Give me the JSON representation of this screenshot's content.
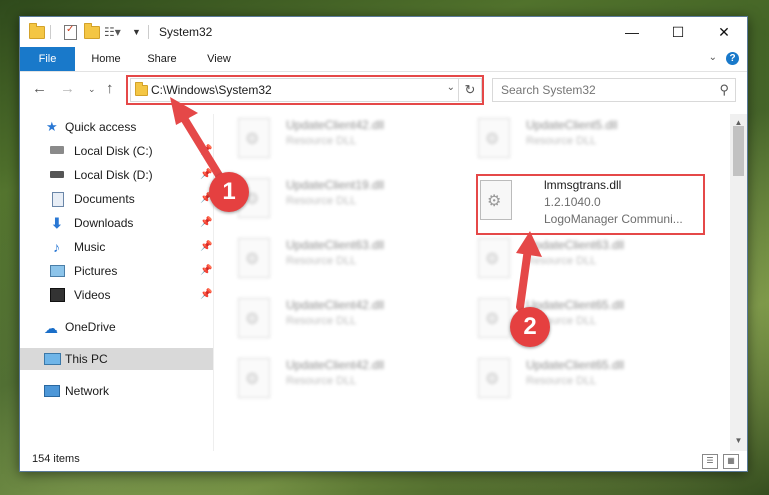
{
  "window": {
    "title": "System32"
  },
  "ribbon": {
    "tabs": [
      "File",
      "Home",
      "Share",
      "View"
    ]
  },
  "nav": {
    "address": "C:\\Windows\\System32",
    "search_placeholder": "Search System32"
  },
  "sidebar": {
    "items": [
      {
        "label": "Quick access"
      },
      {
        "label": "Local Disk (C:)"
      },
      {
        "label": "Local Disk (D:)"
      },
      {
        "label": "Documents"
      },
      {
        "label": "Downloads"
      },
      {
        "label": "Music"
      },
      {
        "label": "Pictures"
      },
      {
        "label": "Videos"
      },
      {
        "label": "OneDrive"
      },
      {
        "label": "This PC"
      },
      {
        "label": "Network"
      }
    ]
  },
  "files": [
    {
      "name": "UpdateClient42.dll",
      "type": "Resource DLL"
    },
    {
      "name": "UpdateClient5.dll",
      "type": "Resource DLL"
    },
    {
      "name": "UpdateClient19.dll",
      "type": "Resource DLL"
    },
    {
      "name": "lmmsgtrans.dll",
      "version": "1.2.1040.0",
      "company": "LogoManager Communi..."
    },
    {
      "name": "UpdateClient63.dll",
      "type": "Resource DLL"
    },
    {
      "name": "UpdateClient63.dll",
      "type": "Resource DLL"
    },
    {
      "name": "UpdateClient42.dll",
      "type": "Resource DLL"
    },
    {
      "name": "UpdateClient65.dll",
      "type": "Resource DLL"
    },
    {
      "name": "UpdateClient42.dll",
      "type": "Resource DLL"
    },
    {
      "name": "UpdateClient65.dll",
      "type": "Resource DLL"
    }
  ],
  "status": {
    "items_count": "154 items"
  },
  "annotations": {
    "step1": "1",
    "step2": "2",
    "color": "#e54848"
  }
}
